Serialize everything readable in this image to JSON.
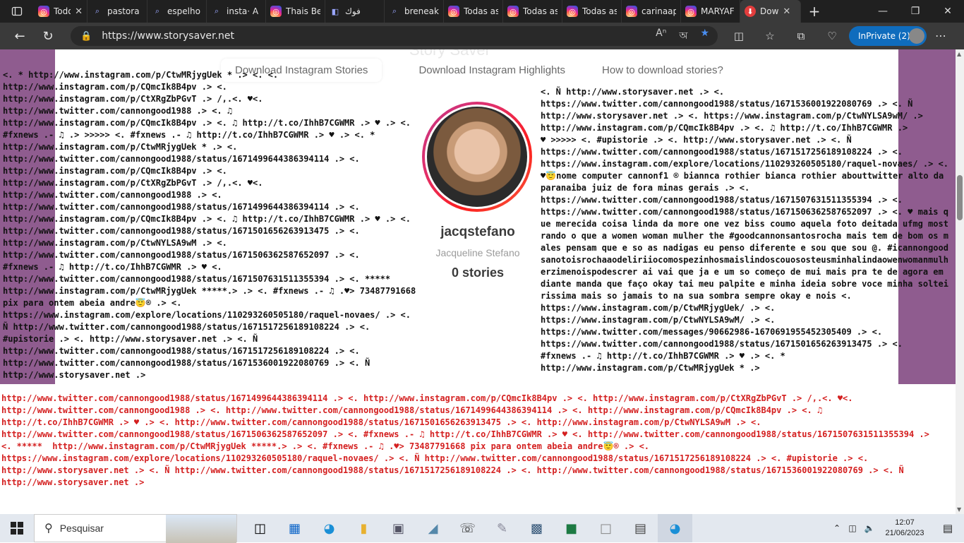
{
  "tabs": [
    {
      "label": "Todo",
      "icon": "instagram-icon",
      "kind": "ig",
      "width": 76
    },
    {
      "label": "pastora r",
      "icon": "search-icon",
      "kind": "srch",
      "width": 85
    },
    {
      "label": "espelho",
      "icon": "search-icon",
      "kind": "srch",
      "width": 84
    },
    {
      "label": "insta· A p",
      "icon": "search-icon",
      "kind": "srch",
      "width": 84
    },
    {
      "label": "Thais Ber",
      "icon": "instagram-icon",
      "kind": "ig",
      "width": 84
    },
    {
      "label": "فوك",
      "icon": "media-icon",
      "kind": "srch",
      "width": 84
    },
    {
      "label": "breneak",
      "icon": "search-icon",
      "kind": "srch",
      "width": 84
    },
    {
      "label": "Todas as",
      "icon": "instagram-icon",
      "kind": "ig",
      "width": 84
    },
    {
      "label": "Todas as",
      "icon": "instagram-icon",
      "kind": "ig",
      "width": 84
    },
    {
      "label": "Todas as",
      "icon": "instagram-icon",
      "kind": "ig",
      "width": 84
    },
    {
      "label": "carinaap",
      "icon": "instagram-icon",
      "kind": "ig",
      "width": 84
    },
    {
      "label": "MARYAF",
      "icon": "instagram-icon",
      "kind": "ig",
      "width": 84
    },
    {
      "label": "Dow",
      "icon": "download-icon",
      "kind": "dl",
      "width": 86,
      "active": true
    }
  ],
  "address": {
    "url": "https://www.storysaver.net",
    "inprivate_label": "InPrivate (2)"
  },
  "page": {
    "ghost_heading": "Story Saver",
    "nav": [
      "Download Instagram Stories",
      "Download Instagram Highlights",
      "How to download stories?"
    ],
    "profile": {
      "username": "jacqstefano",
      "full_name": "Jacqueline Stefano",
      "stories": "0 stories"
    },
    "spam_left": "<. * http://www.instagram.com/p/CtwMRjygUek * .> <. <.\nhttp://www.instagram.com/p/CQmcIk8B4pv .> <.\nhttp://www.instagram.com/p/CtXRgZbPGvT .> /,.<. ♥<.\nhttp://www.twitter.com/cannongood1988 .> <. ♫\nhttp://www.instagram.com/p/CQmcIk8B4pv .> <. ♫ http://t.co/IhhB7CGWMR .> ♥ .> <.\n#fxnews .- ♫ .> >>>>> <. #fxnews .- ♫ http://t.co/IhhB7CGWMR .> ♥ .> <. *\nhttp://www.instagram.com/p/CtwMRjygUek * .> <.\nhttp://www.twitter.com/cannongood1988/status/1671499644386394114 .> <.\nhttp://www.instagram.com/p/CQmcIk8B4pv .> <.\nhttp://www.instagram.com/p/CtXRgZbPGvT .> /,.<. ♥<.\nhttp://www.twitter.com/cannongood1988 .> <.\nhttp://www.twitter.com/cannongood1988/status/1671499644386394114 .> <.\nhttp://www.instagram.com/p/CQmcIk8B4pv .> <. ♫ http://t.co/IhhB7CGWMR .> ♥ .> <.\nhttp://www.twitter.com/cannongood1988/status/1671501656263913475 .> <.\nhttp://www.instagram.com/p/CtwNYLSA9wM .> <.\nhttp://www.twitter.com/cannongood1988/status/1671506362587652097 .> <.\n#fxnews .- ♫ http://t.co/IhhB7CGWMR .> ♥ <.\nhttp://www.twitter.com/cannongood1988/status/1671507631511355394 .> <. *****\nhttp://www.instagram.com/p/CtwMRjygUek *****.> .> <. #fxnews .- ♫ .♥> 73487791668\npix para ontem abeia andre😇® .> <.\nhttps://www.instagram.com/explore/locations/110293260505180/raquel-novaes/ .> <.\nÑ http://www.twitter.com/cannongood1988/status/1671517256189108224 .> <.\n#upistorie .> <. http://www.storysaver.net .> <. Ñ\nhttp://www.twitter.com/cannongood1988/status/1671517256189108224 .> <.\nhttp://www.twitter.com/cannongood1988/status/1671536001922080769 .> <. Ñ\nhttp://www.storysaver.net .>",
    "spam_right": "<. Ñ http://www.storysaver.net .> <.\nhttps://www.twitter.com/cannongood1988/status/1671536001922080769 .> <. Ñ\nhttp://www.storysaver.net .> <. https://www.instagram.com/p/CtwNYLSA9wM/ .>\nhttp://www.instagram.com/p/CQmcIk8B4pv .> <. ♫ http://t.co/IhhB7CGWMR .>\n♥ >>>>> <. #upistorie .> <. http://www.storysaver.net .> <. Ñ\nhttps://www.twitter.com/cannongood1988/status/1671517256189108224 .> <.\nhttps://www.instagram.com/explore/locations/110293260505180/raquel-novaes/ .> <.\n♥😇nome computer cannonf1 ® biannca rothier bianca rothier abouttwitter alto da paranaiba juiz de fora minas gerais .> <.\nhttps://www.twitter.com/cannongood1988/status/1671507631511355394 .> <.\nhttps://www.twitter.com/cannongood1988/status/1671506362587652097 .> <. ♥ mais que merecida coisa linda da more one vez biss coumo aquela foto deitada ufmg mostrando o que a women woman mulher the #goodcannonsantosrocha mais tem de bom os males pensam que e so as nadigas eu penso diferente e sou que sou @. #icannongoodsanotoisrochaaodeliriiocomospezinhosmaislindoscouososteusminhalindaowenwomanmulherzimenoispodescrer ai vai que ja e um so começo de mui mais pra te de agora em diante manda que faço okay tai meu palpite e minha ideia sobre voce minha solteirissima mais so jamais to na sua sombra sempre okay e nois <.\nhttps://www.instagram.com/p/CtwMRjygUek/ .> <.\nhttps://www.instagram.com/p/CtwNYLSA9wM/ .> <.\nhttps://www.twitter.com/messages/90662986-1670691955452305409 .> <.\nhttps://www.twitter.com/cannongood1988/status/1671501656263913475 .> <.\n#fxnews .- ♫ http://t.co/IhhB7CGWMR .> ♥ .> <. *\nhttp://www.instagram.com/p/CtwMRjygUek * .>",
    "spam_red": "http://www.twitter.com/cannongood1988/status/1671499644386394114 .> <. http://www.instagram.com/p/CQmcIk8B4pv .> <. http://www.instagram.com/p/CtXRgZbPGvT .> /,.<. ♥<.\nhttp://www.twitter.com/cannongood1988 .> <. http://www.twitter.com/cannongood1988/status/1671499644386394114 .> <. http://www.instagram.com/p/CQmcIk8B4pv .> <. ♫\nhttp://t.co/IhhB7CGWMR .> ♥ .> <. http://www.twitter.com/cannongood1988/status/1671501656263913475 .> <. http://www.instagram.com/p/CtwNYLSA9wM .> <.\nhttp://www.twitter.com/cannongood1988/status/1671506362587652097 .> <. #fxnews .- ♫ http://t.co/IhhB7CGWMR .> ♥ <. http://www.twitter.com/cannongood1988/status/1671507631511355394 .>\n<. *****  http://www.instagram.com/p/CtwMRjygUek *****.> .> <. #fxnews .- ♫ .♥> 73487791668 pix para ontem abeia andre😇® .> <.\nhttps://www.instagram.com/explore/locations/110293260505180/raquel-novaes/ .> <. Ñ http://www.twitter.com/cannongood1988/status/1671517256189108224 .> <. #upistorie .> <.\nhttp://www.storysaver.net .> <. Ñ http://www.twitter.com/cannongood1988/status/1671517256189108224 .> <. http://www.twitter.com/cannongood1988/status/1671536001922080769 .> <. Ñ\nhttp://www.storysaver.net .>"
  },
  "taskbar": {
    "search_placeholder": "Pesquisar",
    "time": "12:07",
    "date": "21/06/2023"
  },
  "colors": {
    "side_panel": "#8f5c8f",
    "red_text": "#d42020",
    "inprivate": "#0f6cbd"
  }
}
